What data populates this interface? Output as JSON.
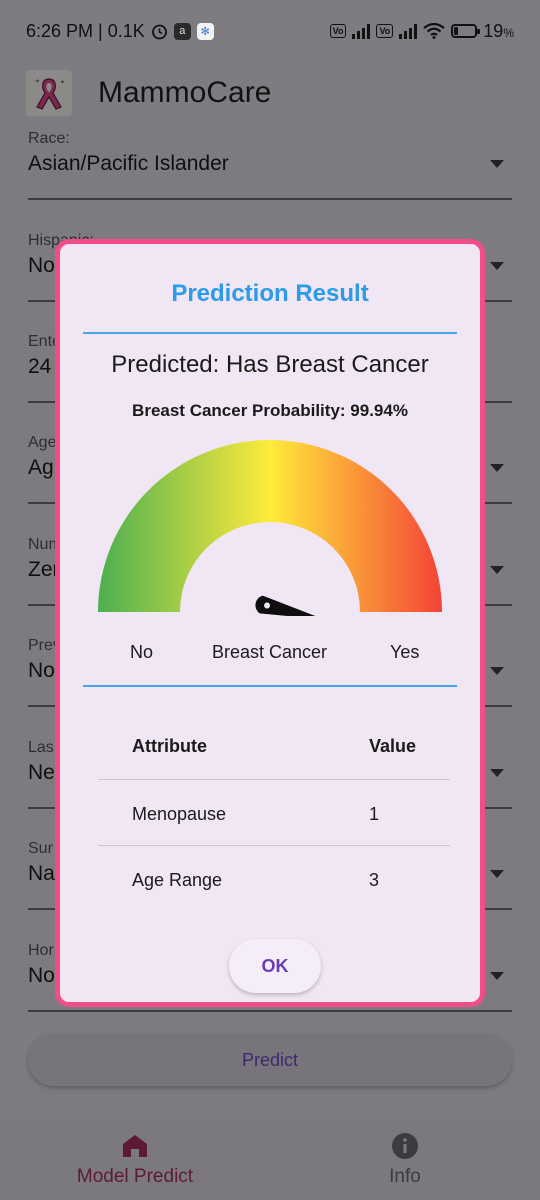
{
  "status_bar": {
    "time_text": "6:26 PM | 0.1K",
    "battery": "19",
    "battery_unit": "%",
    "icons": [
      "alarm-icon",
      "amazon-app-icon",
      "settings-app-icon",
      "volte-icon",
      "signal-icon",
      "5g-icon",
      "wifi-icon",
      "battery-icon"
    ]
  },
  "app_bar": {
    "title": "MammoCare",
    "logo_icon": "pink-ribbon-icon"
  },
  "form": {
    "fields": [
      {
        "label": "Race:",
        "value": "Asian/Pacific Islander"
      },
      {
        "label": "Hispanic:",
        "value": "No"
      },
      {
        "label": "Ente",
        "value": "24"
      },
      {
        "label": "Age",
        "value": "Ag"
      },
      {
        "label": "Num",
        "value": "Zer"
      },
      {
        "label": "Prev",
        "value": "No"
      },
      {
        "label": "Las",
        "value": "Ne"
      },
      {
        "label": "Sur",
        "value": "Na"
      },
      {
        "label": "Hor",
        "value": "No"
      }
    ],
    "predict_label": "Predict"
  },
  "dialog": {
    "title": "Prediction Result",
    "predicted": "Predicted: Has Breast Cancer",
    "probability": "Breast Cancer Probability: 99.94%",
    "gauge": {
      "value": 0.9994,
      "left_label": "No",
      "center_label": "Breast Cancer",
      "right_label": "Yes",
      "colors": [
        "#4caf50",
        "#ffeb3b",
        "#f44336"
      ]
    },
    "table": {
      "headers": [
        "Attribute",
        "Value"
      ],
      "rows": [
        [
          "Menopause",
          "1"
        ],
        [
          "Age Range",
          "3"
        ]
      ]
    },
    "ok_label": "OK",
    "accent_color": "#f04d89",
    "title_color": "#2b9bea"
  },
  "bottom_nav": {
    "items": [
      {
        "label": "Model Predict",
        "icon": "home-icon",
        "active": true
      },
      {
        "label": "Info",
        "icon": "info-icon",
        "active": false
      }
    ]
  }
}
